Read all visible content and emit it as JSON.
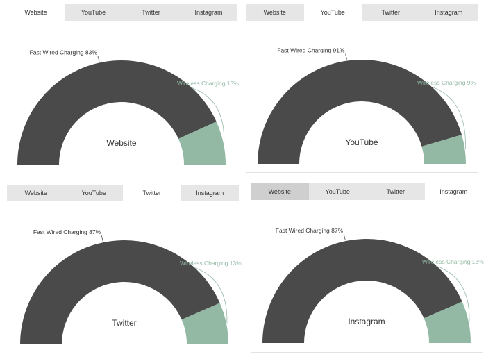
{
  "colors": {
    "fast": "#4a4a4a",
    "wireless": "#93b9a5",
    "tab_bar": "#e6e6e6",
    "tab_active": "#ffffff",
    "tab_pressed": "#cfcfcf"
  },
  "panels": [
    {
      "tabs": [
        {
          "label": "Website",
          "active": true
        },
        {
          "label": "YouTube",
          "active": false
        },
        {
          "label": "Twitter",
          "active": false
        },
        {
          "label": "Instagram",
          "active": false
        }
      ],
      "center_label": "Website",
      "chart_data": {
        "type": "pie",
        "subtype": "semi-donut",
        "categories": [
          "Fast Wired Charging",
          "Wireless Charging"
        ],
        "values": [
          83,
          13
        ],
        "data_labels": [
          "Fast Wired Charging 83%",
          "Wireless Charging 13%"
        ]
      }
    },
    {
      "tabs": [
        {
          "label": "Website",
          "active": false
        },
        {
          "label": "YouTube",
          "active": true
        },
        {
          "label": "Twitter",
          "active": false
        },
        {
          "label": "Instagram",
          "active": false
        }
      ],
      "center_label": "YouTube",
      "chart_data": {
        "type": "pie",
        "subtype": "semi-donut",
        "categories": [
          "Fast Wired Charging",
          "Wireless Charging"
        ],
        "values": [
          91,
          9
        ],
        "data_labels": [
          "Fast Wired Charging 91%",
          "Wireless Charging 9%"
        ]
      }
    },
    {
      "tabs": [
        {
          "label": "Website",
          "active": false
        },
        {
          "label": "YouTube",
          "active": false
        },
        {
          "label": "Twitter",
          "active": true
        },
        {
          "label": "Instagram",
          "active": false
        }
      ],
      "center_label": "Twitter",
      "chart_data": {
        "type": "pie",
        "subtype": "semi-donut",
        "categories": [
          "Fast Wired Charging",
          "Wireless Charging"
        ],
        "values": [
          87,
          13
        ],
        "data_labels": [
          "Fast Wired Charging 87%",
          "Wireless Charging 13%"
        ]
      }
    },
    {
      "tabs": [
        {
          "label": "Website",
          "active": false,
          "pressed": true
        },
        {
          "label": "YouTube",
          "active": false
        },
        {
          "label": "Twitter",
          "active": false
        },
        {
          "label": "Instagram",
          "active": true
        }
      ],
      "center_label": "Instagram",
      "chart_data": {
        "type": "pie",
        "subtype": "semi-donut",
        "categories": [
          "Fast Wired Charging",
          "Wireless Charging"
        ],
        "values": [
          87,
          13
        ],
        "data_labels": [
          "Fast Wired Charging 87%",
          "Wireless Charging 13%"
        ]
      }
    }
  ]
}
